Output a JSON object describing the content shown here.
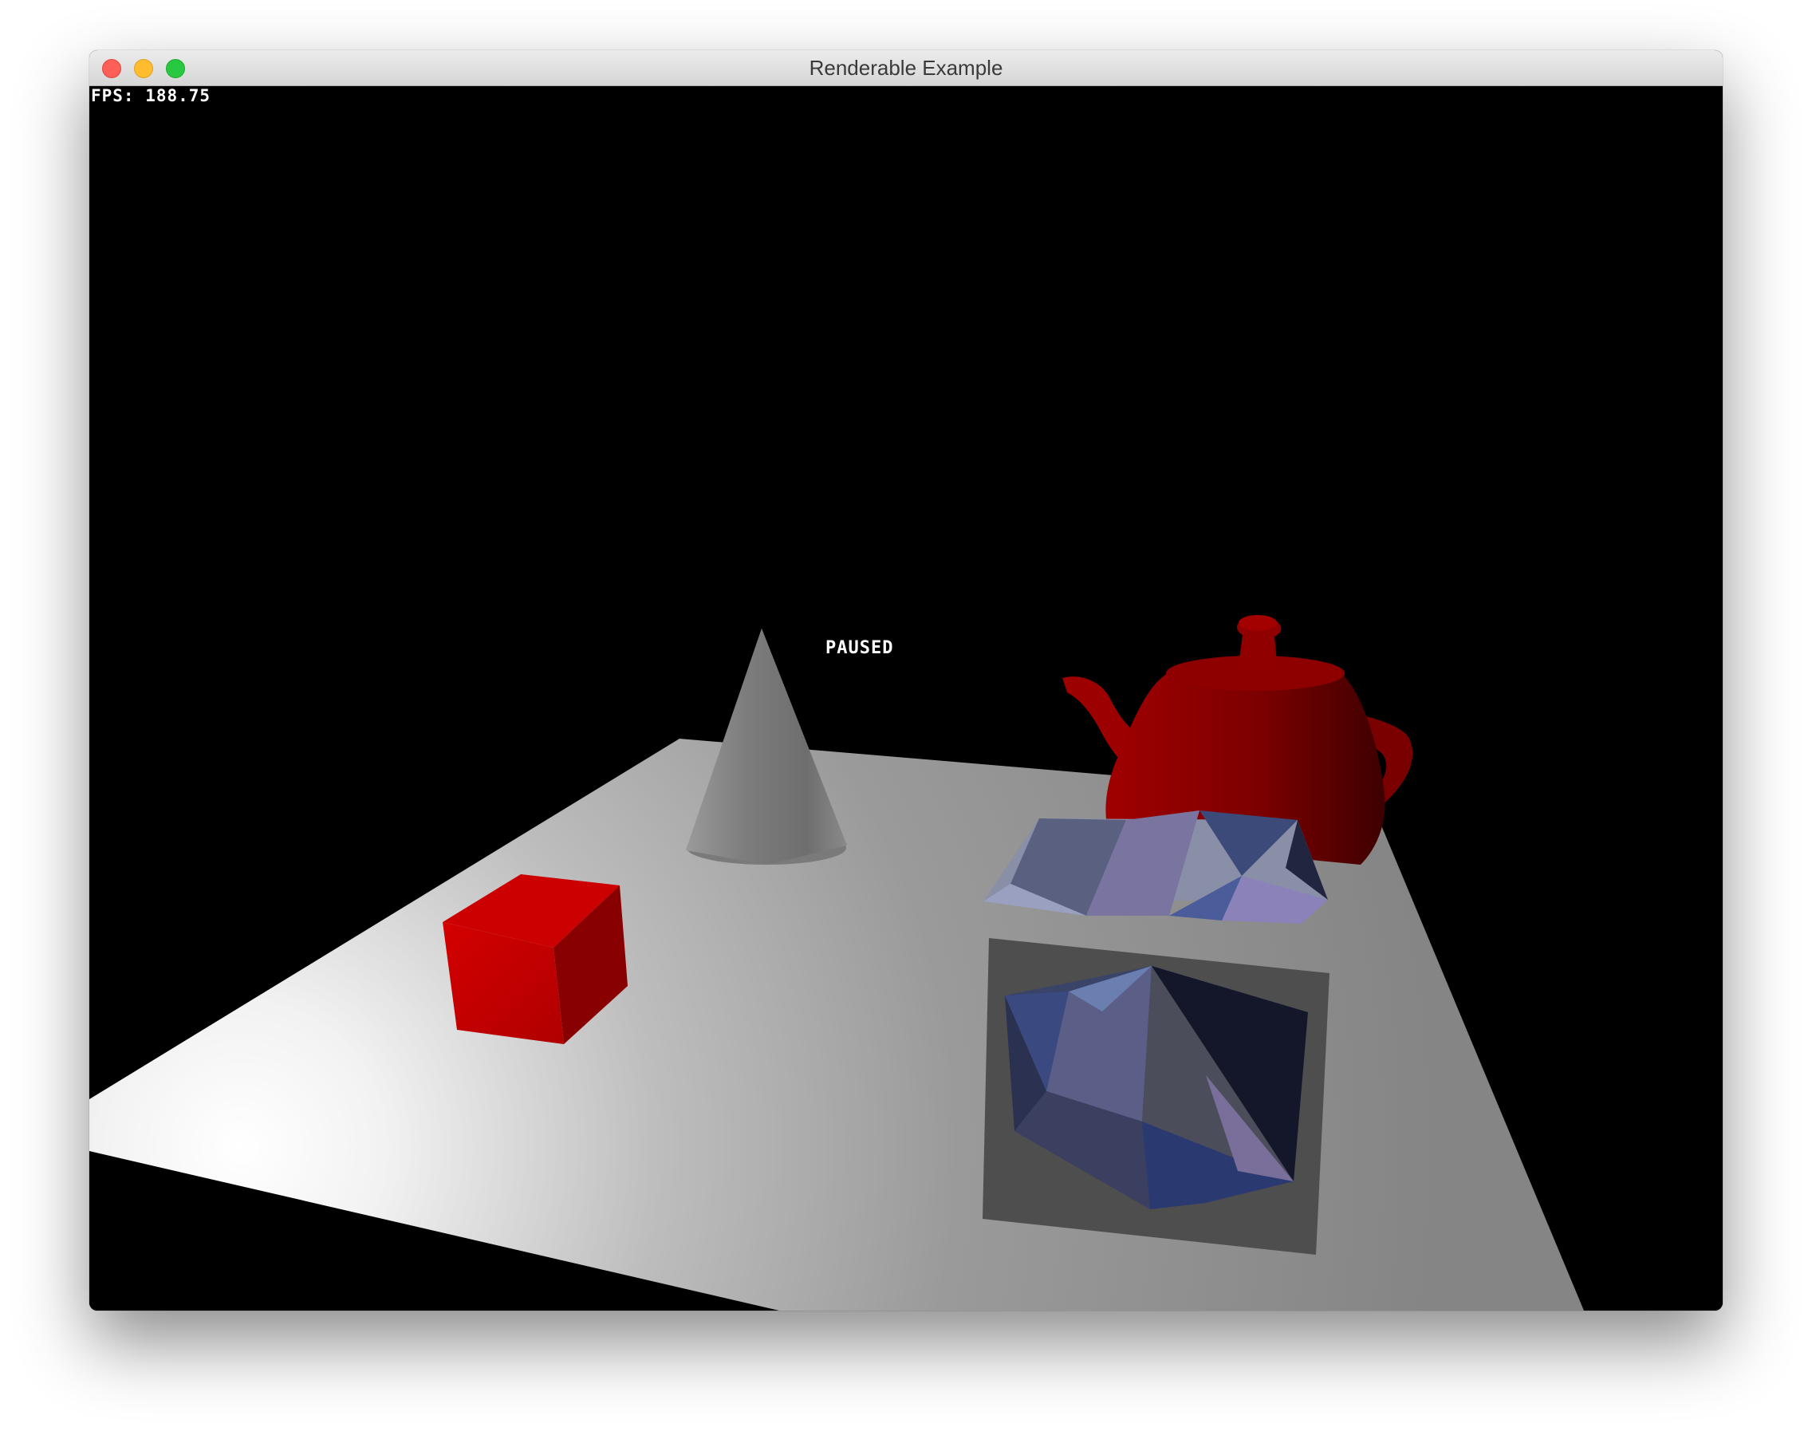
{
  "window": {
    "title": "Renderable Example"
  },
  "hud": {
    "fps": "FPS: 188.75",
    "status": "PAUSED"
  },
  "scene": {
    "background": "#000000",
    "objects": [
      {
        "name": "floor-plane",
        "color": "#c8c8c8"
      },
      {
        "name": "red-cube",
        "color": "#cc0000"
      },
      {
        "name": "grey-cone",
        "color": "#8a8a8a"
      },
      {
        "name": "red-teapot",
        "color": "#8b0000"
      },
      {
        "name": "translucent-box",
        "color": "#6a6a6a"
      },
      {
        "name": "blue-polyhedron",
        "color": "#4a5a8a"
      }
    ]
  }
}
